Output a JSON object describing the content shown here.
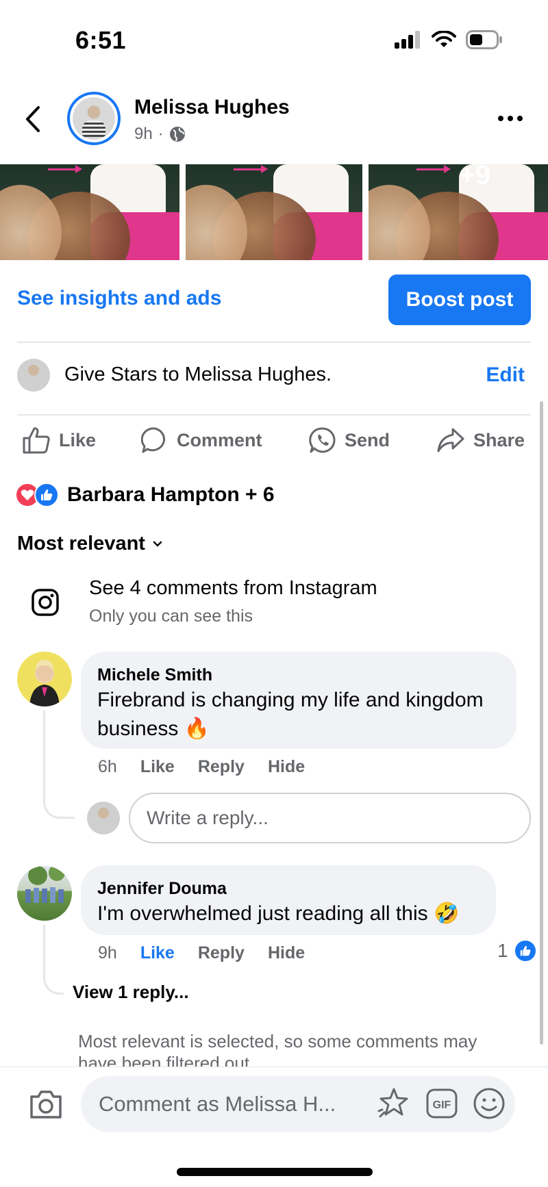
{
  "status_bar": {
    "time": "6:51"
  },
  "header": {
    "author": "Melissa Hughes",
    "time_ago": "9h",
    "separator": "·",
    "back_icon": "chevron-left-icon",
    "privacy_icon": "globe-icon",
    "more_icon": "more-horizontal-icon"
  },
  "photos": {
    "more_count": "+9"
  },
  "insights": {
    "link_label": "See insights and ads",
    "boost_label": "Boost post"
  },
  "stars": {
    "text": "Give Stars to Melissa Hughes.",
    "edit_label": "Edit"
  },
  "actions": [
    {
      "label": "Like",
      "icon": "thumbs-up-icon"
    },
    {
      "label": "Comment",
      "icon": "comment-icon"
    },
    {
      "label": "Send",
      "icon": "whatsapp-icon"
    },
    {
      "label": "Share",
      "icon": "share-icon"
    }
  ],
  "reactions": {
    "names": "Barbara Hampton + 6"
  },
  "sort": {
    "label": "Most relevant"
  },
  "instagram": {
    "title": "See 4 comments from Instagram",
    "subtitle": "Only you can see this"
  },
  "comments": [
    {
      "name": "Michele Smith",
      "text": "Firebrand is changing my life and kingdom business 🔥",
      "time": "6h",
      "like": "Like",
      "reply": "Reply",
      "hide": "Hide"
    },
    {
      "name": "Jennifer Douma",
      "text": "I'm overwhelmed just reading all this 🤣",
      "time": "9h",
      "like": "Like",
      "reply": "Reply",
      "hide": "Hide",
      "like_count": "1",
      "liked_by_viewer": true
    }
  ],
  "reply_box": {
    "placeholder": "Write a reply..."
  },
  "view_replies": "View 1 reply...",
  "filter_note": "Most relevant is selected, so some comments may have been filtered out.",
  "composer": {
    "placeholder": "Comment as Melissa H..."
  },
  "colors": {
    "accent": "#1877f2",
    "heart": "#f33e58",
    "bubble": "#f0f2f5"
  }
}
